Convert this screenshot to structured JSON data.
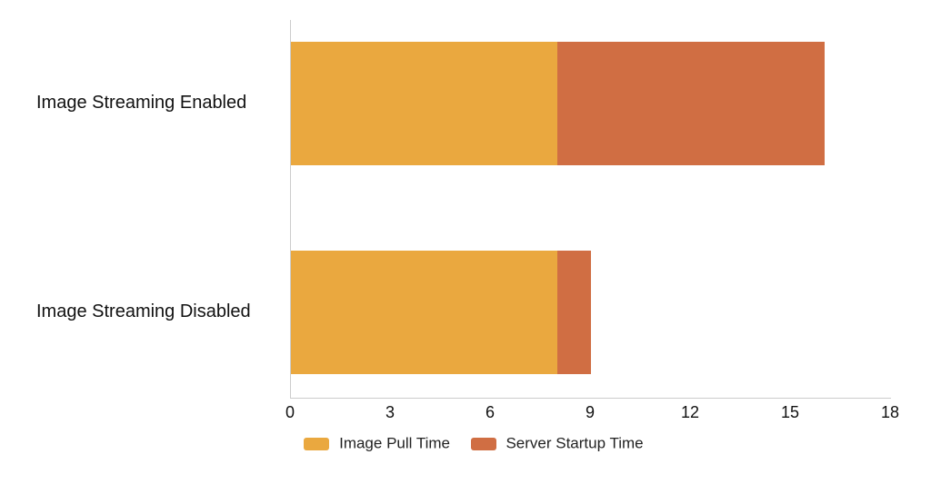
{
  "chart_data": {
    "type": "bar",
    "orientation": "horizontal",
    "stacked": true,
    "categories": [
      "Image Streaming Enabled",
      "Image Streaming Disabled"
    ],
    "series": [
      {
        "name": "Image Pull Time",
        "values": [
          8.0,
          8.0
        ],
        "color": "#eaa83f"
      },
      {
        "name": "Server Startup Time",
        "values": [
          8.0,
          1.0
        ],
        "color": "#d06e43"
      }
    ],
    "xlabel": "",
    "ylabel": "",
    "title": "",
    "xlim": [
      0,
      18
    ],
    "xticks": [
      0,
      3,
      6,
      9,
      12,
      15,
      18
    ],
    "legend_position": "bottom"
  }
}
